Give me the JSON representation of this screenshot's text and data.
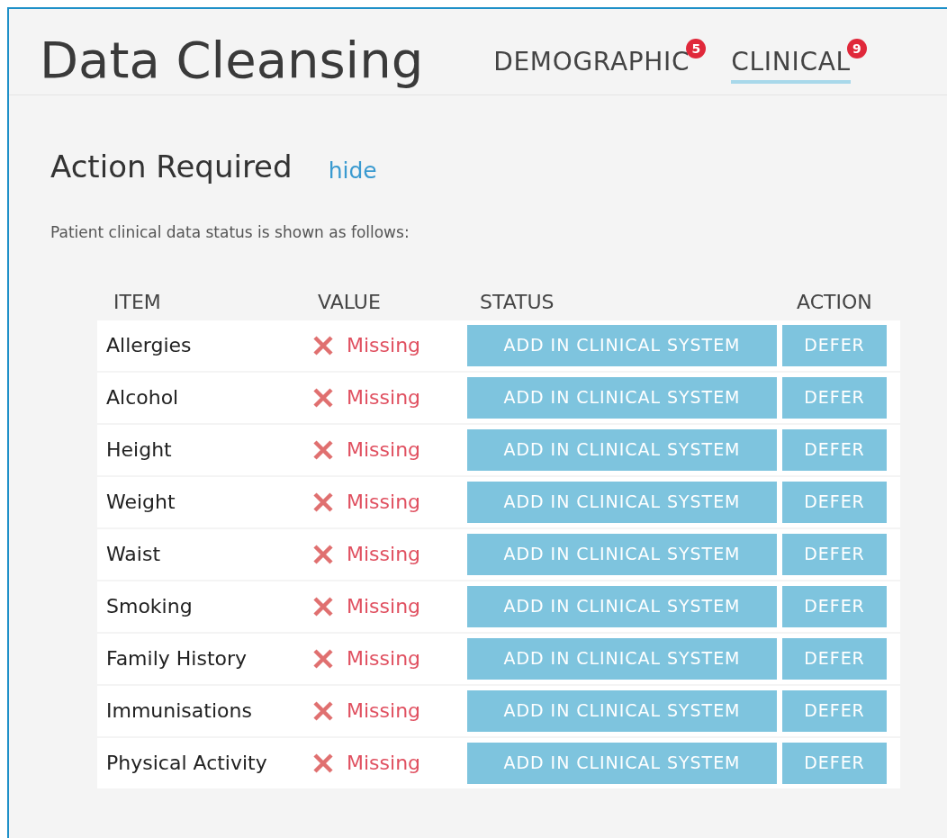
{
  "title": "Data Cleansing",
  "tabs": [
    {
      "label": "DEMOGRAPHIC",
      "badge": "5",
      "selected": false
    },
    {
      "label": "CLINICAL",
      "badge": "9",
      "selected": true
    }
  ],
  "section": {
    "heading": "Action Required",
    "toggle_link": "hide",
    "description": "Patient clinical data status is shown as follows:"
  },
  "table": {
    "columns": [
      "ITEM",
      "VALUE",
      "STATUS",
      "ACTION"
    ],
    "rows": [
      {
        "item": "Allergies",
        "value": "Missing",
        "status_button": "ADD IN CLINICAL SYSTEM",
        "action_button": "DEFER"
      },
      {
        "item": "Alcohol",
        "value": "Missing",
        "status_button": "ADD IN CLINICAL SYSTEM",
        "action_button": "DEFER"
      },
      {
        "item": "Height",
        "value": "Missing",
        "status_button": "ADD IN CLINICAL SYSTEM",
        "action_button": "DEFER"
      },
      {
        "item": "Weight",
        "value": "Missing",
        "status_button": "ADD IN CLINICAL SYSTEM",
        "action_button": "DEFER"
      },
      {
        "item": "Waist",
        "value": "Missing",
        "status_button": "ADD IN CLINICAL SYSTEM",
        "action_button": "DEFER"
      },
      {
        "item": "Smoking",
        "value": "Missing",
        "status_button": "ADD IN CLINICAL SYSTEM",
        "action_button": "DEFER"
      },
      {
        "item": "Family History",
        "value": "Missing",
        "status_button": "ADD IN CLINICAL SYSTEM",
        "action_button": "DEFER"
      },
      {
        "item": "Immunisations",
        "value": "Missing",
        "status_button": "ADD IN CLINICAL SYSTEM",
        "action_button": "DEFER"
      },
      {
        "item": "Physical Activity",
        "value": "Missing",
        "status_button": "ADD IN CLINICAL SYSTEM",
        "action_button": "DEFER"
      }
    ]
  }
}
